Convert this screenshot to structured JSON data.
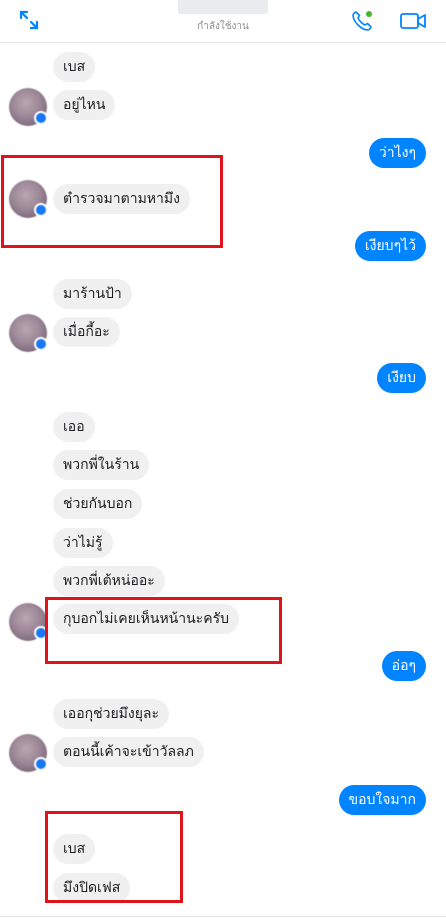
{
  "header": {
    "status": "กำลังใช้งาน",
    "accent_color": "#0084ff"
  },
  "messages": [
    {
      "id": "m1",
      "side": "in",
      "text": "เบส"
    },
    {
      "id": "m2",
      "side": "in",
      "text": "อยู่ไหน"
    },
    {
      "id": "m3",
      "side": "out",
      "text": "ว่าไงๆ"
    },
    {
      "id": "m4",
      "side": "in",
      "text": "ตำรวจมาตามหามึง"
    },
    {
      "id": "m5",
      "side": "out",
      "text": "เงียบๆไว้"
    },
    {
      "id": "m6",
      "side": "in",
      "text": "มาร้านป้า"
    },
    {
      "id": "m7",
      "side": "in",
      "text": "เมื่อกี้อะ"
    },
    {
      "id": "m8",
      "side": "out",
      "text": "เงียบ"
    },
    {
      "id": "m9",
      "side": "in",
      "text": "เออ"
    },
    {
      "id": "m10",
      "side": "in",
      "text": "พวกพี่ในร้าน"
    },
    {
      "id": "m11",
      "side": "in",
      "text": "ช่วยกันบอก"
    },
    {
      "id": "m12",
      "side": "in",
      "text": "ว่าไม่รู้"
    },
    {
      "id": "m13",
      "side": "in",
      "text": "พวกพี่เต้หน่ออะ"
    },
    {
      "id": "m14",
      "side": "in",
      "text": "กุบอกไม่เคยเห็นหน้านะครับ"
    },
    {
      "id": "m15",
      "side": "out",
      "text": "อ่อๆ"
    },
    {
      "id": "m16",
      "side": "in",
      "text": "เออกุช่วยมึงยุละ"
    },
    {
      "id": "m17",
      "side": "in",
      "text": "ตอนนี้เค้าจะเข้าวัลลภ"
    },
    {
      "id": "m18",
      "side": "out",
      "text": "ขอบใจมาก"
    },
    {
      "id": "m19",
      "side": "in",
      "text": "เบส"
    },
    {
      "id": "m20",
      "side": "in",
      "text": "มึงปิดเฟส"
    }
  ],
  "highlight_color": "#e0131a"
}
